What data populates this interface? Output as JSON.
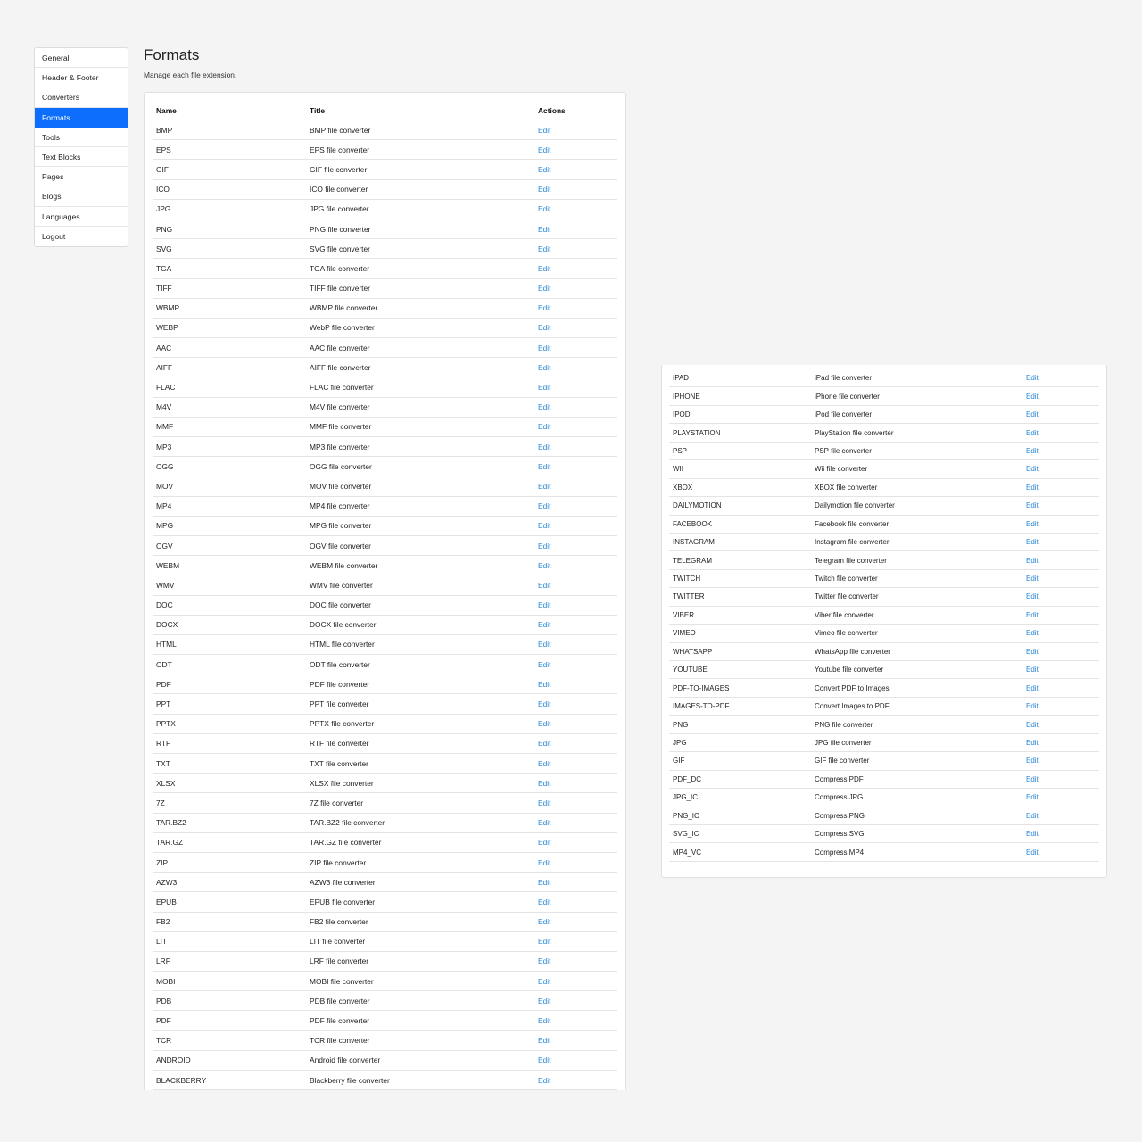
{
  "sidebar": {
    "items": [
      {
        "label": "General",
        "active": false
      },
      {
        "label": "Header & Footer",
        "active": false
      },
      {
        "label": "Converters",
        "active": false
      },
      {
        "label": "Formats",
        "active": true
      },
      {
        "label": "Tools",
        "active": false
      },
      {
        "label": "Text Blocks",
        "active": false
      },
      {
        "label": "Pages",
        "active": false
      },
      {
        "label": "Blogs",
        "active": false
      },
      {
        "label": "Languages",
        "active": false
      },
      {
        "label": "Logout",
        "active": false
      }
    ]
  },
  "header": {
    "title": "Formats",
    "subtitle": "Manage each file extension."
  },
  "table": {
    "columns": [
      "Name",
      "Title",
      "Actions"
    ],
    "action_label": "Edit",
    "rows": [
      {
        "name": "BMP",
        "title": "BMP file converter"
      },
      {
        "name": "EPS",
        "title": "EPS file converter"
      },
      {
        "name": "GIF",
        "title": "GIF file converter"
      },
      {
        "name": "ICO",
        "title": "ICO file converter"
      },
      {
        "name": "JPG",
        "title": "JPG file converter"
      },
      {
        "name": "PNG",
        "title": "PNG file converter"
      },
      {
        "name": "SVG",
        "title": "SVG file converter"
      },
      {
        "name": "TGA",
        "title": "TGA file converter"
      },
      {
        "name": "TIFF",
        "title": "TIFF file converter"
      },
      {
        "name": "WBMP",
        "title": "WBMP file converter"
      },
      {
        "name": "WEBP",
        "title": "WebP file converter"
      },
      {
        "name": "AAC",
        "title": "AAC file converter"
      },
      {
        "name": "AIFF",
        "title": "AIFF file converter"
      },
      {
        "name": "FLAC",
        "title": "FLAC file converter"
      },
      {
        "name": "M4V",
        "title": "M4V file converter"
      },
      {
        "name": "MMF",
        "title": "MMF file converter"
      },
      {
        "name": "MP3",
        "title": "MP3 file converter"
      },
      {
        "name": "OGG",
        "title": "OGG file converter"
      },
      {
        "name": "MOV",
        "title": "MOV file converter"
      },
      {
        "name": "MP4",
        "title": "MP4 file converter"
      },
      {
        "name": "MPG",
        "title": "MPG file converter"
      },
      {
        "name": "OGV",
        "title": "OGV file converter"
      },
      {
        "name": "WEBM",
        "title": "WEBM file converter"
      },
      {
        "name": "WMV",
        "title": "WMV file converter"
      },
      {
        "name": "DOC",
        "title": "DOC file converter"
      },
      {
        "name": "DOCX",
        "title": "DOCX file converter"
      },
      {
        "name": "HTML",
        "title": "HTML file converter"
      },
      {
        "name": "ODT",
        "title": "ODT file converter"
      },
      {
        "name": "PDF",
        "title": "PDF file converter"
      },
      {
        "name": "PPT",
        "title": "PPT file converter"
      },
      {
        "name": "PPTX",
        "title": "PPTX file converter"
      },
      {
        "name": "RTF",
        "title": "RTF file converter"
      },
      {
        "name": "TXT",
        "title": "TXT file converter"
      },
      {
        "name": "XLSX",
        "title": "XLSX file converter"
      },
      {
        "name": "7Z",
        "title": "7Z file converter"
      },
      {
        "name": "TAR.BZ2",
        "title": "TAR.BZ2 file converter"
      },
      {
        "name": "TAR.GZ",
        "title": "TAR.GZ file converter"
      },
      {
        "name": "ZIP",
        "title": "ZIP file converter"
      },
      {
        "name": "AZW3",
        "title": "AZW3 file converter"
      },
      {
        "name": "EPUB",
        "title": "EPUB file converter"
      },
      {
        "name": "FB2",
        "title": "FB2 file converter"
      },
      {
        "name": "LIT",
        "title": "LIT file converter"
      },
      {
        "name": "LRF",
        "title": "LRF file converter"
      },
      {
        "name": "MOBI",
        "title": "MOBI file converter"
      },
      {
        "name": "PDB",
        "title": "PDB file converter"
      },
      {
        "name": "PDF",
        "title": "PDF file converter"
      },
      {
        "name": "TCR",
        "title": "TCR file converter"
      },
      {
        "name": "ANDROID",
        "title": "Android file converter"
      },
      {
        "name": "BLACKBERRY",
        "title": "Blackberry file converter"
      }
    ]
  },
  "continued_table": {
    "action_label": "Edit",
    "rows": [
      {
        "name": "IPAD",
        "title": "iPad file converter"
      },
      {
        "name": "IPHONE",
        "title": "iPhone file converter"
      },
      {
        "name": "IPOD",
        "title": "iPod file converter"
      },
      {
        "name": "PLAYSTATION",
        "title": "PlayStation file converter"
      },
      {
        "name": "PSP",
        "title": "PSP file converter"
      },
      {
        "name": "WII",
        "title": "Wii file converter"
      },
      {
        "name": "XBOX",
        "title": "XBOX file converter"
      },
      {
        "name": "DAILYMOTION",
        "title": "Dailymotion file converter"
      },
      {
        "name": "FACEBOOK",
        "title": "Facebook file converter"
      },
      {
        "name": "INSTAGRAM",
        "title": "Instagram file converter"
      },
      {
        "name": "TELEGRAM",
        "title": "Telegram file converter"
      },
      {
        "name": "TWITCH",
        "title": "Twitch file converter"
      },
      {
        "name": "TWITTER",
        "title": "Twitter file converter"
      },
      {
        "name": "VIBER",
        "title": "Viber file converter"
      },
      {
        "name": "VIMEO",
        "title": "Vimeo file converter"
      },
      {
        "name": "WHATSAPP",
        "title": "WhatsApp file converter"
      },
      {
        "name": "YOUTUBE",
        "title": "Youtube file converter"
      },
      {
        "name": "PDF-TO-IMAGES",
        "title": "Convert PDF to Images"
      },
      {
        "name": "IMAGES-TO-PDF",
        "title": "Convert Images to PDF"
      },
      {
        "name": "PNG",
        "title": "PNG file converter"
      },
      {
        "name": "JPG",
        "title": "JPG file converter"
      },
      {
        "name": "GIF",
        "title": "GIF file converter"
      },
      {
        "name": "PDF_DC",
        "title": "Compress PDF"
      },
      {
        "name": "JPG_IC",
        "title": "Compress JPG"
      },
      {
        "name": "PNG_IC",
        "title": "Compress PNG"
      },
      {
        "name": "SVG_IC",
        "title": "Compress SVG"
      },
      {
        "name": "MP4_VC",
        "title": "Compress MP4"
      }
    ]
  },
  "colors": {
    "accent": "#0d6efd",
    "link": "#2a88d8",
    "background": "#f4f4f4"
  }
}
